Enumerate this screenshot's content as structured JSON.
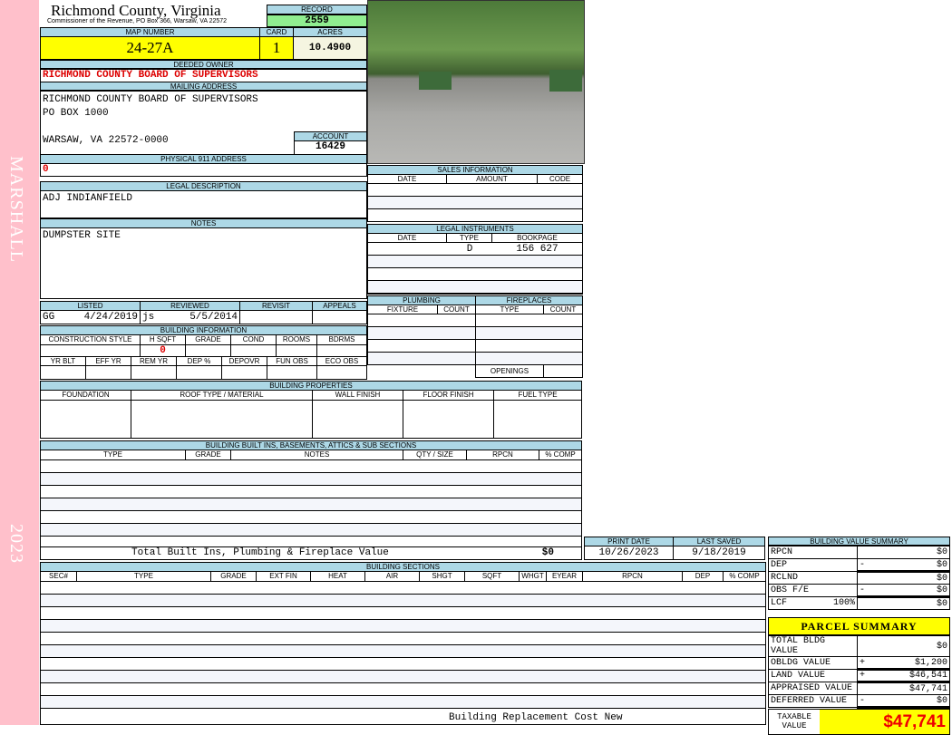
{
  "sidebar": {
    "district": "MARSHALL",
    "year": "2023"
  },
  "header": {
    "county": "Richmond County, Virginia",
    "subtitle": "Commissioner of the Revenue, PO Box 366, Warsaw, VA 22572",
    "record_label": "RECORD",
    "record": "2559",
    "map_label": "MAP NUMBER",
    "map": "24-27A",
    "card_label": "CARD",
    "card": "1",
    "acres_label": "ACRES",
    "acres": "10.4900"
  },
  "owner": {
    "label": "DEEDED OWNER",
    "value": "RICHMOND COUNTY BOARD OF SUPERVISORS"
  },
  "mailing": {
    "label": "MAILING ADDRESS",
    "line1": "RICHMOND COUNTY BOARD OF SUPERVISORS",
    "line2": "PO BOX  1000",
    "line3": "WARSAW, VA 22572-0000",
    "account_label": "ACCOUNT",
    "account": "16429"
  },
  "physical": {
    "label": "PHYSICAL 911 ADDRESS",
    "value": "0"
  },
  "legal": {
    "label": "LEGAL DESCRIPTION",
    "value": "ADJ INDIANFIELD"
  },
  "notes": {
    "label": "NOTES",
    "value": "DUMPSTER SITE"
  },
  "review": {
    "listed_label": "LISTED",
    "reviewed_label": "REVIEWED",
    "revisit_label": "REVISIT",
    "appeals_label": "APPEALS",
    "listed_by": "GG",
    "listed_date": "4/24/2019",
    "reviewed_by": "js",
    "reviewed_date": "5/5/2014"
  },
  "building_info": {
    "label": "BUILDING INFORMATION",
    "cols1": [
      "CONSTRUCTION STYLE",
      "H SQFT",
      "GRADE",
      "COND",
      "ROOMS",
      "BDRMS"
    ],
    "hsqft": "0",
    "cols2": [
      "YR BLT",
      "EFF YR",
      "REM YR",
      "DEP %",
      "DEPOVR",
      "FUN OBS",
      "ECO OBS"
    ]
  },
  "building_props": {
    "label": "BUILDING PROPERTIES",
    "cols": [
      "FOUNDATION",
      "ROOF TYPE / MATERIAL",
      "WALL FINISH",
      "FLOOR FINISH",
      "FUEL TYPE"
    ]
  },
  "builtins": {
    "label": "BUILDING BUILT INS, BASEMENTS, ATTICS & SUB SECTIONS",
    "cols": [
      "TYPE",
      "GRADE",
      "NOTES",
      "QTY / SIZE",
      "RPCN",
      "% COMP"
    ],
    "total_label": "Total Built Ins, Plumbing & Fireplace Value",
    "total": "$0"
  },
  "dates": {
    "print_label": "PRINT DATE",
    "print": "10/26/2023",
    "saved_label": "LAST SAVED",
    "saved": "9/18/2019"
  },
  "sections": {
    "label": "BUILDING SECTIONS",
    "cols": [
      "SEC#",
      "TYPE",
      "GRADE",
      "EXT FIN",
      "HEAT",
      "AIR",
      "SHGT",
      "SQFT",
      "WHGT",
      "EYEAR",
      "RPCN",
      "DEP",
      "% COMP"
    ],
    "footer": "Building Replacement Cost New"
  },
  "sales": {
    "label": "SALES INFORMATION",
    "cols": [
      "DATE",
      "AMOUNT",
      "CODE"
    ]
  },
  "instruments": {
    "label": "LEGAL INSTRUMENTS",
    "cols": [
      "DATE",
      "TYPE",
      "BOOKPAGE"
    ],
    "type": "D",
    "bookpage": "156 627"
  },
  "plumbing": {
    "label": "PLUMBING",
    "cols": [
      "FIXTURE",
      "COUNT"
    ]
  },
  "fireplaces": {
    "label": "FIREPLACES",
    "cols": [
      "TYPE",
      "COUNT"
    ],
    "openings": "OPENINGS"
  },
  "value_summary": {
    "label": "BUILDING VALUE SUMMARY",
    "rows": [
      {
        "k": "RPCN",
        "op": "",
        "v": "$0"
      },
      {
        "k": "DEP",
        "op": "-",
        "v": "$0"
      },
      {
        "k": "RCLND",
        "op": "",
        "v": "$0"
      },
      {
        "k": "OBS F/E",
        "op": "-",
        "v": "$0"
      },
      {
        "k": "LCF",
        "pct": "100%",
        "op": "",
        "v": "$0"
      }
    ]
  },
  "parcel": {
    "title": "PARCEL SUMMARY",
    "rows": [
      {
        "k": "TOTAL BLDG VALUE",
        "op": "",
        "v": "$0"
      },
      {
        "k": "OBLDG VALUE",
        "op": "+",
        "v": "$1,200"
      },
      {
        "k": "LAND VALUE",
        "op": "+",
        "v": "$46,541"
      },
      {
        "k": "APPRAISED VALUE",
        "op": "",
        "v": "$47,741"
      },
      {
        "k": "DEFERRED VALUE",
        "op": "-",
        "v": "$0"
      }
    ],
    "taxable_label": "TAXABLE VALUE",
    "taxable": "$47,741"
  }
}
